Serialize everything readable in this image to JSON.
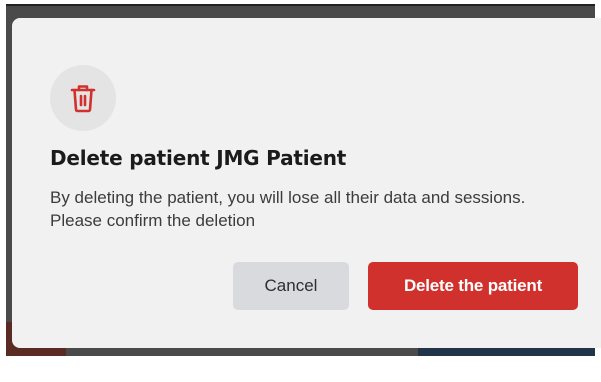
{
  "dialog": {
    "icon": "trash-icon",
    "title": "Delete patient JMG Patient",
    "description": "By deleting the patient, you will lose all their data and sessions. Please confirm the deletion",
    "cancel_label": "Cancel",
    "confirm_label": "Delete the patient"
  },
  "colors": {
    "accent": "#d1312d",
    "dialog_background": "#f1f1f1",
    "icon_circle": "#e4e4e4",
    "cancel_button": "#d9dade"
  }
}
